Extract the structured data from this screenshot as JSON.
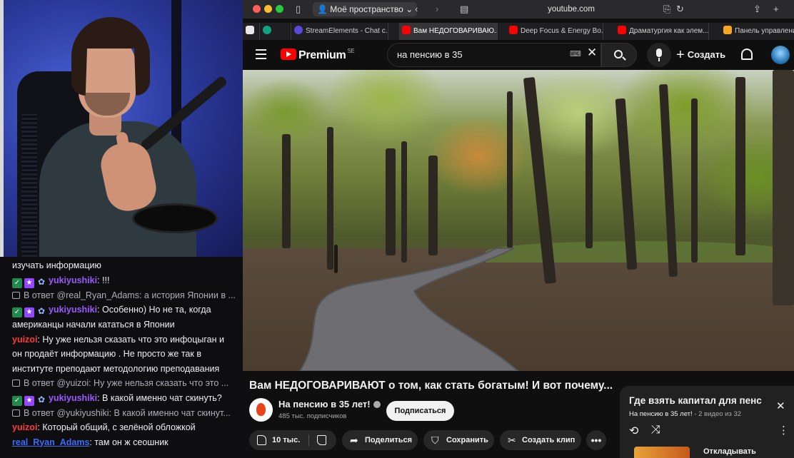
{
  "chat": {
    "lines": [
      {
        "type": "text",
        "text": "изучать информацию"
      },
      {
        "type": "msg",
        "user": "yukiyushiki",
        "text": ": !!!"
      },
      {
        "type": "reply",
        "text": "В ответ @real_Ryan_Adams: а история Японии в ..."
      },
      {
        "type": "msg",
        "user": "yukiyushiki",
        "text": ": Особенно) Но не та, когда"
      },
      {
        "type": "text",
        "text": "американцы начали кататься в Японии"
      },
      {
        "type": "msg2",
        "user": "yuizoi",
        "text": ": Ну уже нельзя сказать что это инфоцыган и"
      },
      {
        "type": "text",
        "text": "он продаёт информацию . Не просто же так в"
      },
      {
        "type": "text",
        "text": "институте преподают методологию преподавания"
      },
      {
        "type": "reply",
        "text": "В ответ @yuizoi: Ну уже нельзя сказать что это ..."
      },
      {
        "type": "msg",
        "user": "yukiyushiki",
        "text": ": В какой именно чат скинуть?"
      },
      {
        "type": "reply",
        "text": "В ответ @yukiyushiki: В какой именно чат скинут..."
      },
      {
        "type": "msg2",
        "user": "yuizoi",
        "text": ": Который общий, с зелёной обложкой"
      },
      {
        "type": "msg3",
        "user": "real_Ryan_Adams",
        "text": ": там он ж сеошник"
      }
    ]
  },
  "browser": {
    "space_label": "Моё пространство",
    "address": "youtube.com",
    "tabs": [
      {
        "label": "StreamElements - Chat c...",
        "icon": "streamelements-icon",
        "active": false
      },
      {
        "label": "Вам НЕДОГОВАРИВАЮ...",
        "icon": "youtube-icon",
        "active": true
      },
      {
        "label": "Deep Focus & Energy Bo...",
        "icon": "youtube-icon",
        "active": false
      },
      {
        "label": "Драматургия как элем...",
        "icon": "youtube-icon",
        "active": false
      },
      {
        "label": "Панель управления",
        "icon": "d-icon",
        "active": false
      }
    ]
  },
  "youtube": {
    "logo_text": "Premium",
    "logo_badge": "SE",
    "search_value": "на пенсию в 35",
    "create_label": "Создать",
    "video_title": "Вам НЕДОГОВАРИВАЮТ о том, как стать богатым! И вот почему...",
    "channel_name": "На пенсию в 35 лет!",
    "subscribers": "485 тыс. подписчиков",
    "subscribe_label": "Подписаться",
    "like_count": "10 тыс.",
    "share_label": "Поделиться",
    "save_label": "Сохранить",
    "clip_label": "Создать клип",
    "more_label": "•••"
  },
  "playlist": {
    "title": "Где взять капитал для пенс",
    "channel": "На пенсию в 35 лет!",
    "meta": " - 2 видео из 32",
    "item_title": "Откладывать"
  },
  "colors": {
    "accent_red": "#ff0000",
    "nick_yuki": "#9b59ff",
    "nick_yuizoi": "#ff3b3b",
    "nick_ryan": "#3a6cf7"
  }
}
